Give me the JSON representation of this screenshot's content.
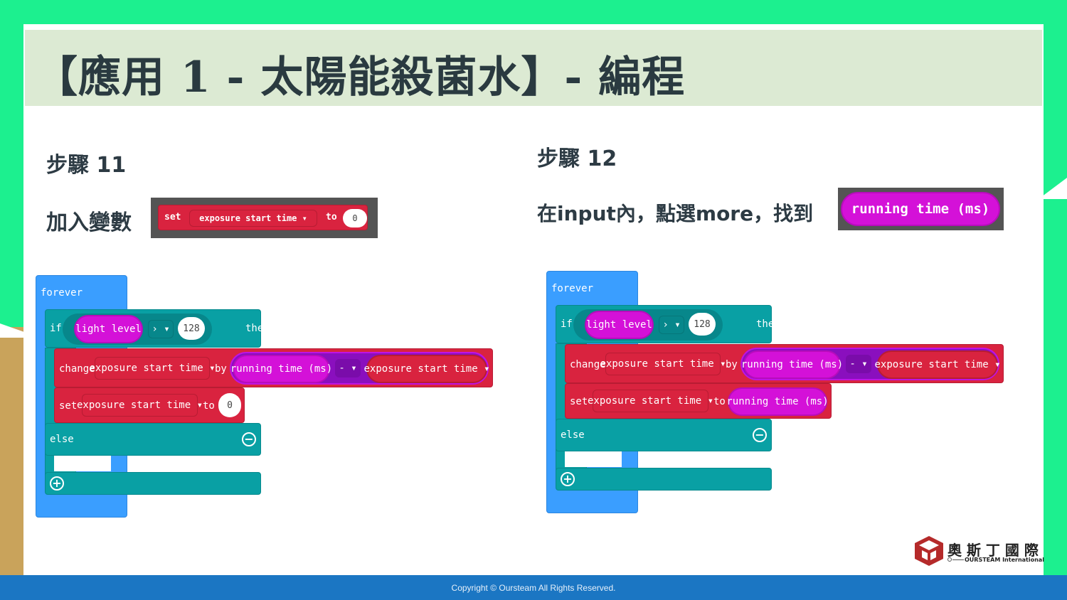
{
  "title": "【應用 1 - 太陽能殺菌水】- 編程",
  "left": {
    "step": "步驟 11",
    "instruction": "加入變數",
    "snippet": {
      "set": "set",
      "var": "exposure start time ▾",
      "to": "to",
      "val": "0"
    },
    "code": {
      "forever": "forever",
      "if": "if",
      "light_level": "light level",
      "op": "› ▾",
      "num": "128",
      "then": "then",
      "change": "change",
      "var": "exposure start time ▾",
      "by": "by",
      "running": "running time (ms)",
      "minus": "- ▾",
      "var2": "exposure start time ▾",
      "set": "set",
      "var3": "exposure start time ▾",
      "to": "to",
      "zero": "0",
      "else": "else"
    }
  },
  "right": {
    "step": "步驟 12",
    "instruction": "在input內，點選more，找到",
    "snippet": "running time (ms)",
    "code": {
      "forever": "forever",
      "if": "if",
      "light_level": "light level",
      "op": "› ▾",
      "num": "128",
      "then": "then",
      "change": "change",
      "var": "exposure start time ▾",
      "by": "by",
      "running": "running time (ms)",
      "minus": "- ▾",
      "var2": "exposure start time ▾",
      "set": "set",
      "var3": "exposure start time ▾",
      "to": "to",
      "running2": "running time (ms)",
      "else": "else"
    }
  },
  "logo": {
    "name": "奧 斯 丁 國 際",
    "sub": "OURSTEAM International"
  },
  "footer": "Copyright © Oursteam All Rights Reserved."
}
